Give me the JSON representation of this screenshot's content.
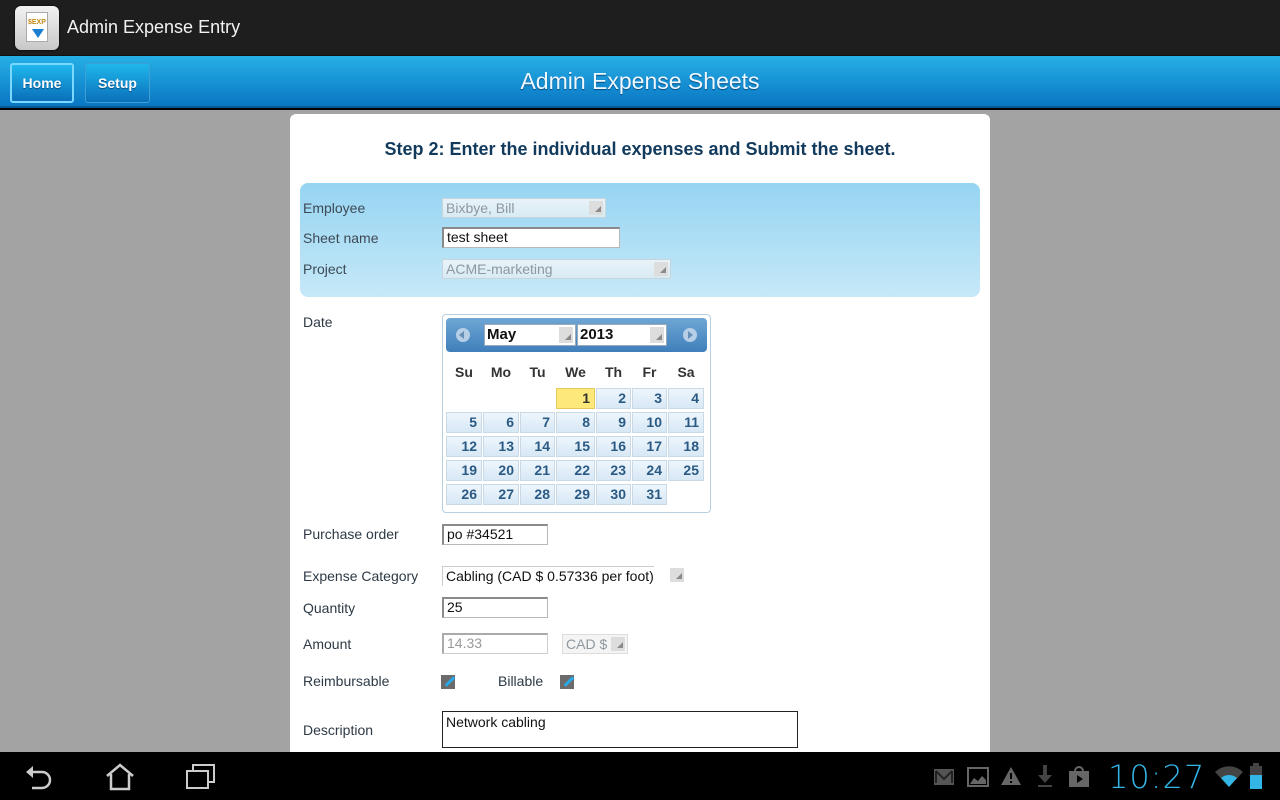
{
  "titlebar": {
    "app_icon": "expense-app-icon",
    "title": "Admin Expense Entry",
    "icon_symbol": "$EXP"
  },
  "navbar": {
    "home_label": "Home",
    "setup_label": "Setup",
    "title": "Admin Expense Sheets",
    "active_tab": "Home"
  },
  "form": {
    "step_text": "Step 2: Enter the individual expenses and Submit the sheet.",
    "employee": {
      "label": "Employee",
      "value": "Bixbye, Bill",
      "disabled": true
    },
    "sheet_name": {
      "label": "Sheet name",
      "value": "test sheet"
    },
    "project": {
      "label": "Project",
      "value": "ACME-marketing",
      "disabled": true
    },
    "date": {
      "label": "Date",
      "month": "May",
      "year": "2013",
      "selected_day": 1,
      "weekdays": [
        "Su",
        "Mo",
        "Tu",
        "We",
        "Th",
        "Fr",
        "Sa"
      ],
      "first_weekday_index": 3,
      "days_in_month": 31
    },
    "purchase_order": {
      "label": "Purchase order",
      "value": "po #34521"
    },
    "expense_category": {
      "label": "Expense Category",
      "value": "Cabling (CAD $ 0.57336 per foot)"
    },
    "quantity": {
      "label": "Quantity",
      "value": "25"
    },
    "amount": {
      "label": "Amount",
      "value": "14.33",
      "currency": "CAD $",
      "disabled": true
    },
    "reimbursable": {
      "label": "Reimbursable",
      "checked": true
    },
    "billable": {
      "label": "Billable",
      "checked": true
    },
    "description": {
      "label": "Description",
      "value": "Network cabling"
    }
  },
  "system_bar": {
    "nav_icons": [
      "back-icon",
      "home-icon",
      "recent-apps-icon"
    ],
    "notification_icons": [
      "gmail-icon",
      "gallery-icon",
      "warning-icon",
      "download-icon",
      "play-store-icon"
    ],
    "clock": "10:27",
    "status_icons": [
      "wifi-icon",
      "battery-icon"
    ]
  },
  "colors": {
    "accent": "#33b5e5",
    "navbar": "#0a76c3",
    "step_text": "#123a5c",
    "selected_day": "#fce97a"
  }
}
